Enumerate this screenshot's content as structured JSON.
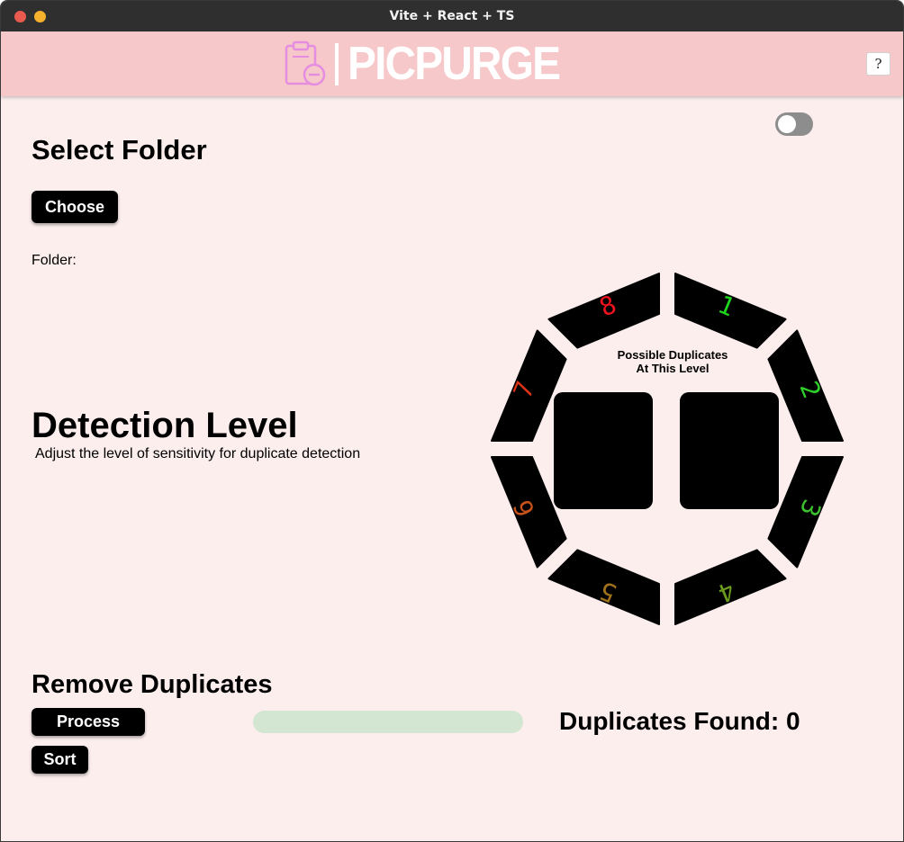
{
  "window": {
    "title": "Vite + React + TS"
  },
  "header": {
    "brand": "PICPURGE",
    "help_label": "?"
  },
  "theme_toggle": {
    "on": false
  },
  "select_folder": {
    "heading": "Select Folder",
    "choose_label": "Choose",
    "folder_label": "Folder:"
  },
  "detection": {
    "heading": "Detection Level",
    "description": "Adjust the level of sensitivity for duplicate detection",
    "wheel_label_line1": "Possible Duplicates",
    "wheel_label_line2": "At This Level",
    "levels": [
      {
        "label": "1",
        "color": "#1fd51f"
      },
      {
        "label": "2",
        "color": "#2fd02a"
      },
      {
        "label": "3",
        "color": "#3cc12f"
      },
      {
        "label": "4",
        "color": "#6c9a1d"
      },
      {
        "label": "5",
        "color": "#a0721b"
      },
      {
        "label": "6",
        "color": "#c8521a"
      },
      {
        "label": "7",
        "color": "#dc3316"
      },
      {
        "label": "8",
        "color": "#f0131d"
      }
    ]
  },
  "remove": {
    "heading": "Remove Duplicates",
    "process_label": "Process",
    "sort_label": "Sort",
    "progress_fraction": 0,
    "found_label": "Duplicates Found: 0"
  },
  "colors": {
    "background": "#fbeeed",
    "header": "#f6c8c9",
    "logo_icon": "#e58de0",
    "progress_track": "#d3e6d2"
  }
}
